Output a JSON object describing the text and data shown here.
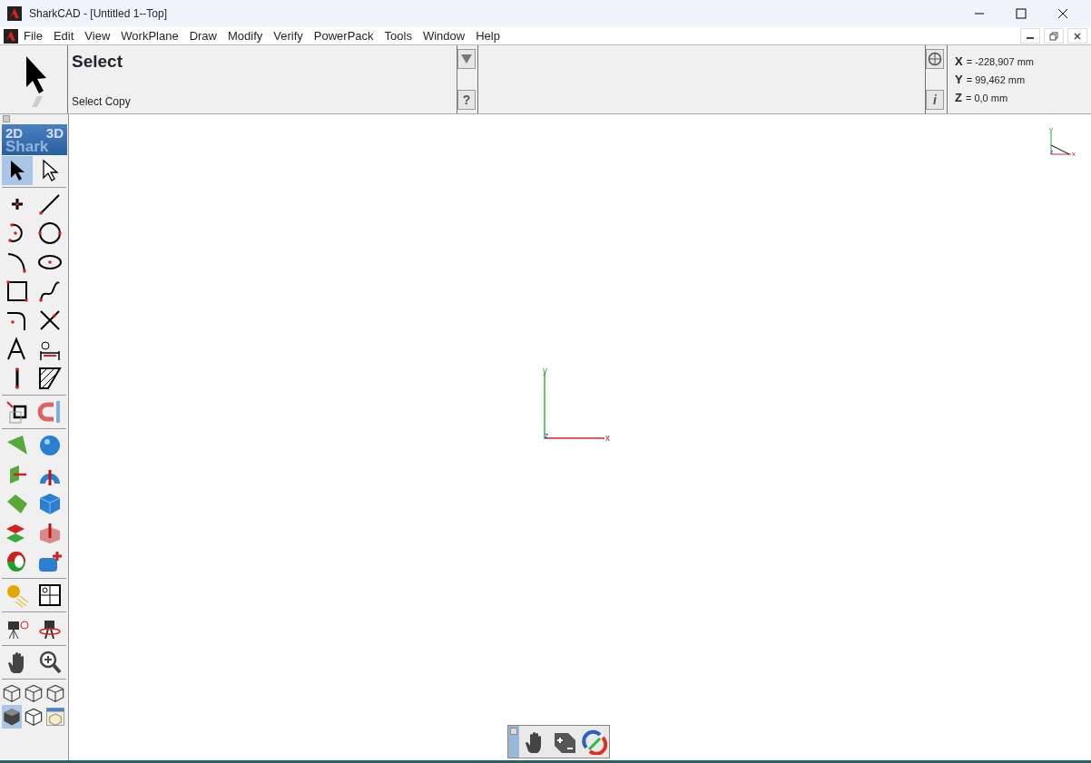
{
  "window": {
    "title": "SharkCAD - [Untitled 1--Top]"
  },
  "menu": [
    "File",
    "Edit",
    "View",
    "WorkPlane",
    "Draw",
    "Modify",
    "Verify",
    "PowerPack",
    "Tools",
    "Window",
    "Help"
  ],
  "command": {
    "title": "Select",
    "prompt": "Select Copy",
    "help": "?",
    "info": "i"
  },
  "coordinates": [
    {
      "axis": "X",
      "value": "= -228,907 mm"
    },
    {
      "axis": "Y",
      "value": "= 99,462 mm"
    },
    {
      "axis": "Z",
      "value": "= 0,0 mm"
    }
  ],
  "logo": {
    "left": "2D",
    "right": "3D",
    "bottom": "Shark"
  },
  "tool_groups": [
    [
      {
        "kind": "select",
        "selected": true
      },
      {
        "kind": "select-outline",
        "selected": false
      }
    ],
    [
      {
        "kind": "point",
        "selected": false
      },
      {
        "kind": "line",
        "selected": false
      },
      {
        "kind": "arc3",
        "selected": false
      },
      {
        "kind": "circle",
        "selected": false
      },
      {
        "kind": "arc",
        "selected": false
      },
      {
        "kind": "ellipse",
        "selected": false
      },
      {
        "kind": "rectangle",
        "selected": false
      },
      {
        "kind": "spline",
        "selected": false
      },
      {
        "kind": "fillet",
        "selected": false
      },
      {
        "kind": "trim",
        "selected": false
      },
      {
        "kind": "text",
        "selected": false
      },
      {
        "kind": "dimension",
        "selected": false
      },
      {
        "kind": "vline",
        "selected": false
      },
      {
        "kind": "hatch",
        "selected": false
      }
    ],
    [
      {
        "kind": "transform",
        "selected": false
      },
      {
        "kind": "magnet",
        "selected": false
      }
    ],
    [
      {
        "kind": "triangle",
        "selected": false
      },
      {
        "kind": "sphere",
        "selected": false
      },
      {
        "kind": "plane",
        "selected": false
      },
      {
        "kind": "revolve",
        "selected": false
      },
      {
        "kind": "surface",
        "selected": false
      },
      {
        "kind": "cube",
        "selected": false
      },
      {
        "kind": "planes",
        "selected": false
      },
      {
        "kind": "extrude",
        "selected": false
      },
      {
        "kind": "ring",
        "selected": false
      },
      {
        "kind": "solid-add",
        "selected": false
      }
    ],
    [
      {
        "kind": "light",
        "selected": false
      },
      {
        "kind": "viewports",
        "selected": false
      }
    ],
    [
      {
        "kind": "camera",
        "selected": false
      },
      {
        "kind": "walk",
        "selected": false
      }
    ],
    [
      {
        "kind": "hand",
        "selected": false
      },
      {
        "kind": "zoom",
        "selected": false
      }
    ],
    [
      {
        "kind": "wire-cube",
        "selected": false
      },
      {
        "kind": "wire-cube",
        "selected": false
      },
      {
        "kind": "wire-cube",
        "selected": false
      },
      {
        "kind": "shaded-cube",
        "selected": true
      },
      {
        "kind": "outline-cube",
        "selected": false
      },
      {
        "kind": "window-cube",
        "selected": false
      }
    ]
  ],
  "axes": {
    "y": "y",
    "z": "z",
    "x": "x"
  },
  "mini_axes": {
    "y": "y",
    "z": "z",
    "x": "x"
  },
  "view_tools": [
    {
      "kind": "hand"
    },
    {
      "kind": "zoom-box"
    },
    {
      "kind": "rotate"
    }
  ]
}
